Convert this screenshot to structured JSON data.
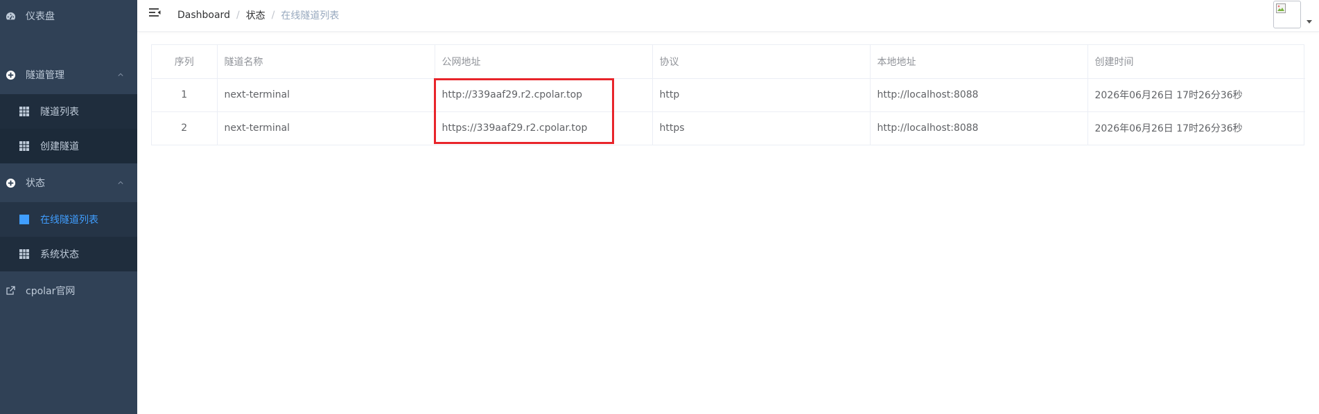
{
  "sidebar": {
    "dashboard": {
      "label": "仪表盘",
      "icon": "dashboard-icon"
    },
    "tunnel_mgmt": {
      "label": "隧道管理",
      "icon": "plus-circle-icon",
      "items": [
        {
          "label": "隧道列表",
          "icon": "table-icon"
        },
        {
          "label": "创建隧道",
          "icon": "table-icon"
        }
      ]
    },
    "status": {
      "label": "状态",
      "icon": "plus-circle-icon",
      "items": [
        {
          "label": "在线隧道列表",
          "icon": "table-icon",
          "active": true
        },
        {
          "label": "系统状态",
          "icon": "table-icon"
        }
      ]
    },
    "official": {
      "label": "cpolar官网",
      "icon": "external-link-icon"
    }
  },
  "header": {
    "breadcrumb": [
      "Dashboard",
      "状态",
      "在线隧道列表"
    ],
    "separator": "/"
  },
  "table": {
    "columns": [
      "序列",
      "隧道名称",
      "公网地址",
      "协议",
      "本地地址",
      "创建时间"
    ],
    "rows": [
      [
        "1",
        "next-terminal",
        "http://339aaf29.r2.cpolar.top",
        "http",
        "http://localhost:8088",
        "2026年06月26日 17时26分36秒"
      ],
      [
        "2",
        "next-terminal",
        "https://339aaf29.r2.cpolar.top",
        "https",
        "http://localhost:8088",
        "2026年06月26日 17时26分36秒"
      ]
    ]
  },
  "colors": {
    "sidebar_bg": "#304156",
    "submenu_bg": "#1f2d3d",
    "active": "#409eff",
    "highlight": "#e8242a"
  }
}
